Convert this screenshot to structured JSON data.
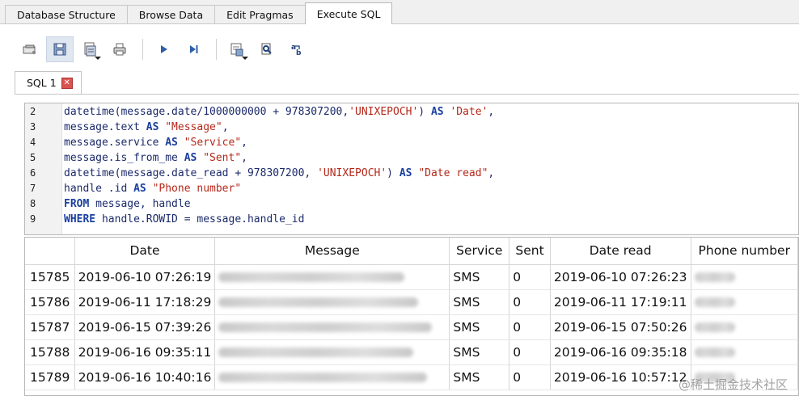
{
  "main_tabs": [
    {
      "label": "Database Structure",
      "active": false
    },
    {
      "label": "Browse Data",
      "active": false
    },
    {
      "label": "Edit Pragmas",
      "active": false
    },
    {
      "label": "Execute SQL",
      "active": true
    }
  ],
  "toolbar": {
    "icons": [
      "open-tab-icon",
      "save-sql-icon",
      "open-file-icon",
      "print-icon",
      "execute-all-icon",
      "execute-line-icon",
      "save-results-icon",
      "find-icon",
      "find-replace-icon"
    ]
  },
  "sql_tab": {
    "label": "SQL 1"
  },
  "editor": {
    "lines": [
      {
        "n": "2",
        "tokens": [
          [
            "f",
            "datetime(message.date/1000000000 + 978307200,"
          ],
          [
            "s",
            "'UNIXEPOCH'"
          ],
          [
            "f",
            ") "
          ],
          [
            "k",
            "AS"
          ],
          [
            "f",
            " "
          ],
          [
            "s",
            "'Date'"
          ],
          [
            "f",
            ","
          ]
        ]
      },
      {
        "n": "3",
        "tokens": [
          [
            "f",
            "message.text "
          ],
          [
            "k",
            "AS"
          ],
          [
            "f",
            " "
          ],
          [
            "s",
            "\"Message\""
          ],
          [
            "f",
            ","
          ]
        ]
      },
      {
        "n": "4",
        "tokens": [
          [
            "f",
            "message.service "
          ],
          [
            "k",
            "AS"
          ],
          [
            "f",
            " "
          ],
          [
            "s",
            "\"Service\""
          ],
          [
            "f",
            ","
          ]
        ]
      },
      {
        "n": "5",
        "tokens": [
          [
            "f",
            "message.is_from_me "
          ],
          [
            "k",
            "AS"
          ],
          [
            "f",
            " "
          ],
          [
            "s",
            "\"Sent\""
          ],
          [
            "f",
            ","
          ]
        ]
      },
      {
        "n": "6",
        "tokens": [
          [
            "f",
            "datetime(message.date_read + 978307200, "
          ],
          [
            "s",
            "'UNIXEPOCH'"
          ],
          [
            "f",
            ") "
          ],
          [
            "k",
            "AS"
          ],
          [
            "f",
            " "
          ],
          [
            "s",
            "\"Date read\""
          ],
          [
            "f",
            ","
          ]
        ]
      },
      {
        "n": "7",
        "tokens": [
          [
            "f",
            "handle .id "
          ],
          [
            "k",
            "AS"
          ],
          [
            "f",
            " "
          ],
          [
            "s",
            "\"Phone number\""
          ]
        ]
      },
      {
        "n": "8",
        "tokens": [
          [
            "k",
            "FROM"
          ],
          [
            "f",
            " message, handle"
          ]
        ]
      },
      {
        "n": "9",
        "tokens": [
          [
            "k",
            "WHERE"
          ],
          [
            "f",
            " handle.ROWID = message.handle_id"
          ]
        ]
      }
    ]
  },
  "results": {
    "columns": [
      "",
      "Date",
      "Message",
      "Service",
      "Sent",
      "Date read",
      "Phone number"
    ],
    "rows": [
      {
        "id": "15785",
        "date": "2019-06-10 07:26:19",
        "service": "SMS",
        "sent": "0",
        "date_read": "2019-06-10 07:26:23"
      },
      {
        "id": "15786",
        "date": "2019-06-11 17:18:29",
        "service": "SMS",
        "sent": "0",
        "date_read": "2019-06-11 17:19:11"
      },
      {
        "id": "15787",
        "date": "2019-06-15 07:39:26",
        "service": "SMS",
        "sent": "0",
        "date_read": "2019-06-15 07:50:26"
      },
      {
        "id": "15788",
        "date": "2019-06-16 09:35:11",
        "service": "SMS",
        "sent": "0",
        "date_read": "2019-06-16 09:35:18"
      },
      {
        "id": "15789",
        "date": "2019-06-16 10:40:16",
        "service": "SMS",
        "sent": "0",
        "date_read": "2019-06-16 10:57:12"
      }
    ]
  },
  "watermark": "@稀土掘金技术社区"
}
